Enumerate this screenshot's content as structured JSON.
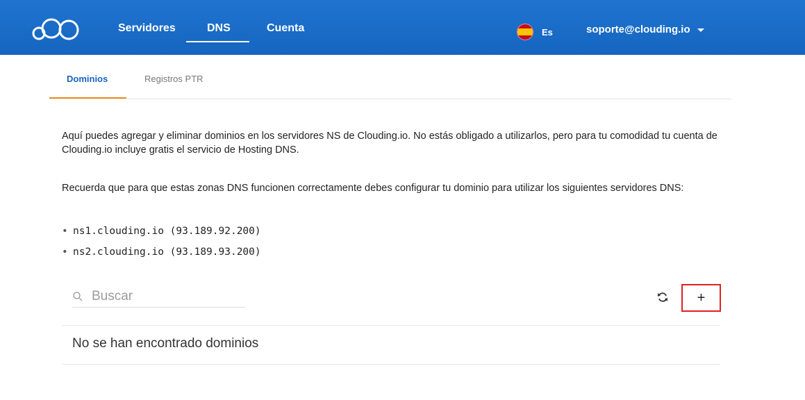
{
  "header": {
    "nav": [
      {
        "label": "Servidores"
      },
      {
        "label": "DNS"
      },
      {
        "label": "Cuenta"
      }
    ],
    "language": "Es",
    "account_email": "soporte@clouding.io",
    "colors": {
      "background": "#1565c0",
      "active_underline": "#ffffff"
    }
  },
  "tabs": [
    {
      "label": "Dominios",
      "active": true
    },
    {
      "label": "Registros PTR",
      "active": false
    }
  ],
  "content": {
    "intro": "Aquí puedes agregar y eliminar dominios en los servidores NS de Clouding.io. No estás obligado a utilizarlos, pero para tu comodidad tu cuenta de Clouding.io incluye gratis el servicio de Hosting DNS.",
    "reminder": "Recuerda que para que estas zonas DNS funcionen correctamente debes configurar tu dominio para utilizar los siguientes servidores DNS:",
    "nameservers": [
      "ns1.clouding.io (93.189.92.200)",
      "ns2.clouding.io (93.189.93.200)"
    ]
  },
  "search": {
    "placeholder": "Buscar",
    "value": ""
  },
  "actions": {
    "add_label": "+",
    "refresh_icon": "refresh-icon"
  },
  "results": {
    "empty_message": "No se han encontrado dominios"
  }
}
